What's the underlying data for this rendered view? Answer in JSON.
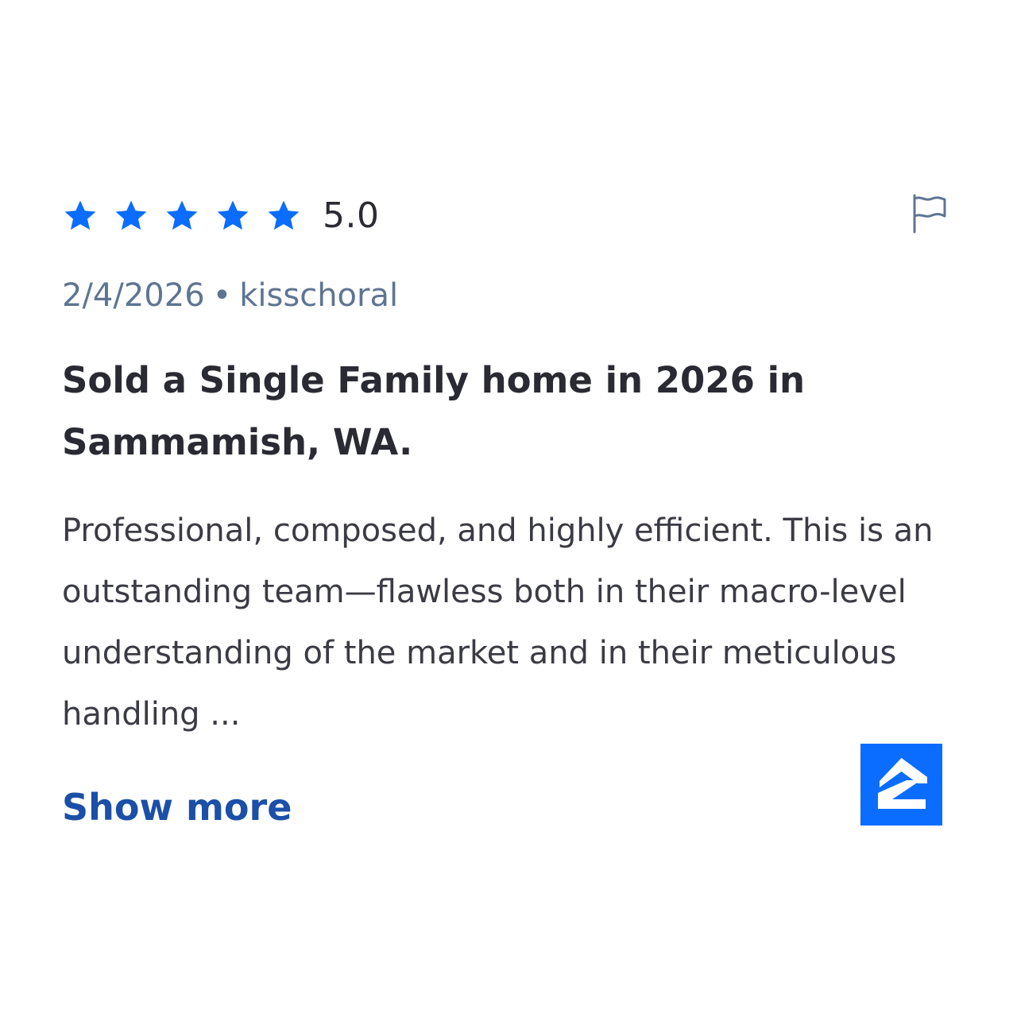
{
  "review": {
    "rating": 5,
    "rating_value": "5.0",
    "date": "2/4/2026",
    "separator": "•",
    "reviewer": "kisschoral",
    "title": "Sold a Single Family home in 2026 in Sammamish, WA.",
    "body": "Professional, composed, and highly efficient. This is an outstanding team—flawless both in their macro-level understanding of the market and in their meticulous handling ...",
    "show_more_label": "Show more"
  },
  "icons": {
    "star": "star-icon",
    "flag": "flag-icon",
    "brand": "zillow-logo-icon"
  },
  "colors": {
    "star": "#0a6dff",
    "rating_text": "#2a2a33",
    "meta_text": "#5e7592",
    "title_text": "#2a2a33",
    "body_text": "#3b3b44",
    "link": "#1b4fa8",
    "brand_bg": "#0a6dff"
  }
}
